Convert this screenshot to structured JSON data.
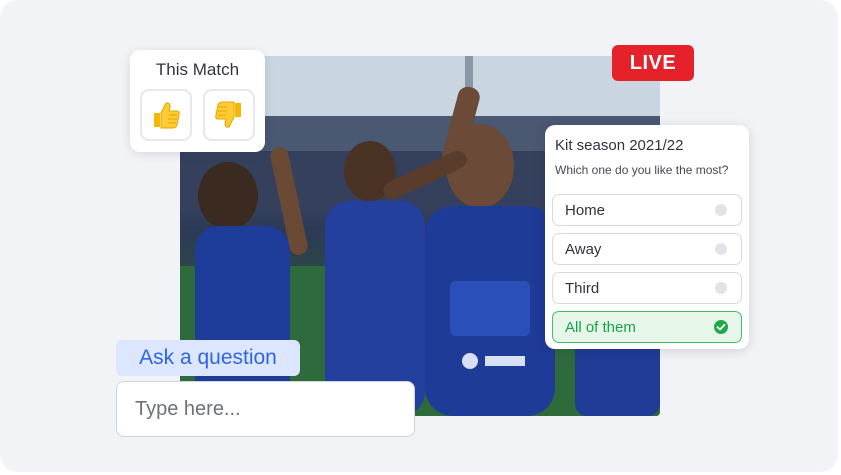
{
  "live_badge": "LIVE",
  "this_match": {
    "title": "This Match",
    "buttons": [
      {
        "icon": "thumbs-up-icon"
      },
      {
        "icon": "thumbs-down-icon"
      }
    ]
  },
  "poll": {
    "title": "Kit season 2021/22",
    "question": "Which one do you like the most?",
    "options": [
      {
        "label": "Home",
        "selected": false
      },
      {
        "label": "Away",
        "selected": false
      },
      {
        "label": "Third",
        "selected": false
      },
      {
        "label": "All of them",
        "selected": true
      }
    ]
  },
  "question_box": {
    "label": "Ask a question",
    "placeholder": "Type here..."
  },
  "colors": {
    "live": "#e5222a",
    "selected_green": "#20a84c",
    "accent_blue": "#2f66e0"
  }
}
